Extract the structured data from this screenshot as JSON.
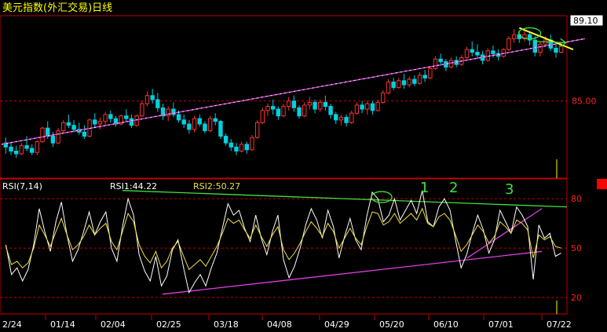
{
  "header": {
    "title": "美元指数(外汇交易)日线"
  },
  "chart_data": [
    {
      "type": "candlestick",
      "title": "美元指数(外汇交易)日线",
      "ylim": [
        79.3,
        91.3
      ],
      "y_ticks": [
        85.0
      ],
      "last_price_label": "89.10",
      "x_tick_labels": [
        "2/24",
        "01/14",
        "02/04",
        "02/25",
        "03/18",
        "04/08",
        "04/29",
        "05/20",
        "06/10",
        "07/01",
        "07/22"
      ],
      "series": [
        {
          "name": "",
          "values": [
            [
              81.9,
              82.3,
              81.1,
              81.6
            ],
            [
              81.6,
              81.9,
              81.0,
              81.3
            ],
            [
              81.3,
              81.7,
              80.8,
              81.1
            ],
            [
              81.1,
              81.9,
              81.0,
              81.7
            ],
            [
              81.7,
              82.4,
              81.3,
              81.5
            ],
            [
              81.5,
              81.8,
              81.0,
              81.2
            ],
            [
              81.2,
              82.1,
              81.0,
              82.0
            ],
            [
              82.0,
              83.1,
              81.9,
              83.0
            ],
            [
              83.0,
              83.5,
              82.2,
              82.4
            ],
            [
              82.4,
              82.7,
              81.6,
              81.9
            ],
            [
              81.9,
              83.0,
              81.8,
              82.8
            ],
            [
              82.8,
              83.6,
              82.6,
              83.4
            ],
            [
              83.4,
              84.0,
              83.0,
              83.2
            ],
            [
              83.2,
              83.6,
              82.7,
              82.9
            ],
            [
              82.9,
              83.4,
              82.5,
              82.7
            ],
            [
              82.7,
              83.2,
              82.2,
              82.4
            ],
            [
              82.4,
              83.7,
              82.3,
              83.6
            ],
            [
              83.6,
              84.1,
              83.0,
              83.3
            ],
            [
              83.3,
              83.8,
              82.9,
              83.5
            ],
            [
              83.5,
              84.2,
              83.2,
              84.0
            ],
            [
              84.0,
              84.3,
              83.4,
              83.7
            ],
            [
              83.7,
              83.9,
              83.1,
              83.3
            ],
            [
              83.3,
              84.0,
              83.2,
              83.9
            ],
            [
              83.9,
              84.4,
              83.5,
              83.7
            ],
            [
              83.7,
              84.0,
              83.0,
              83.2
            ],
            [
              83.2,
              84.0,
              83.1,
              83.9
            ],
            [
              83.9,
              85.0,
              83.8,
              84.8
            ],
            [
              84.8,
              85.7,
              84.6,
              85.4
            ],
            [
              85.4,
              85.9,
              84.8,
              85.1
            ],
            [
              85.1,
              85.6,
              84.2,
              84.5
            ],
            [
              84.5,
              84.8,
              83.6,
              83.9
            ],
            [
              83.9,
              84.6,
              83.5,
              84.4
            ],
            [
              84.4,
              84.9,
              83.8,
              84.0
            ],
            [
              84.0,
              84.3,
              83.4,
              83.6
            ],
            [
              83.6,
              84.0,
              83.0,
              83.3
            ],
            [
              83.3,
              83.6,
              82.6,
              82.9
            ],
            [
              82.9,
              83.9,
              82.7,
              83.7
            ],
            [
              83.7,
              84.0,
              83.1,
              83.3
            ],
            [
              83.3,
              83.5,
              82.6,
              82.8
            ],
            [
              82.8,
              83.9,
              82.7,
              83.7
            ],
            [
              83.7,
              84.1,
              83.2,
              83.5
            ],
            [
              83.5,
              83.6,
              82.2,
              82.4
            ],
            [
              82.4,
              82.6,
              81.7,
              81.9
            ],
            [
              81.9,
              82.2,
              81.3,
              81.6
            ],
            [
              81.6,
              81.9,
              81.0,
              81.3
            ],
            [
              81.3,
              82.0,
              81.2,
              81.8
            ],
            [
              81.8,
              82.0,
              81.1,
              81.4
            ],
            [
              81.4,
              82.5,
              81.3,
              82.3
            ],
            [
              82.3,
              83.6,
              82.2,
              83.4
            ],
            [
              83.4,
              84.5,
              83.3,
              84.3
            ],
            [
              84.3,
              84.8,
              83.9,
              84.6
            ],
            [
              84.6,
              85.1,
              84.0,
              84.4
            ],
            [
              84.4,
              84.6,
              83.6,
              83.9
            ],
            [
              83.9,
              84.8,
              83.8,
              84.6
            ],
            [
              84.6,
              85.3,
              84.3,
              85.0
            ],
            [
              85.0,
              85.4,
              84.2,
              84.5
            ],
            [
              84.5,
              84.7,
              83.7,
              83.9
            ],
            [
              83.9,
              84.9,
              83.8,
              84.7
            ],
            [
              84.7,
              85.3,
              84.4,
              84.9
            ],
            [
              84.9,
              85.1,
              84.1,
              84.4
            ],
            [
              84.4,
              85.1,
              84.2,
              84.9
            ],
            [
              84.9,
              85.4,
              84.3,
              84.6
            ],
            [
              84.6,
              84.8,
              83.7,
              84.0
            ],
            [
              84.0,
              84.2,
              83.3,
              83.6
            ],
            [
              83.6,
              84.0,
              83.2,
              83.8
            ],
            [
              83.8,
              84.0,
              83.1,
              83.4
            ],
            [
              83.4,
              84.3,
              83.3,
              84.1
            ],
            [
              84.1,
              84.9,
              84.0,
              84.7
            ],
            [
              84.7,
              85.0,
              84.1,
              84.4
            ],
            [
              84.4,
              85.0,
              84.0,
              84.8
            ],
            [
              84.8,
              85.0,
              84.0,
              84.3
            ],
            [
              84.3,
              85.1,
              84.2,
              84.9
            ],
            [
              84.9,
              85.8,
              84.8,
              85.6
            ],
            [
              85.6,
              86.6,
              85.5,
              86.4
            ],
            [
              86.4,
              86.7,
              85.8,
              86.0
            ],
            [
              86.0,
              86.7,
              85.9,
              86.5
            ],
            [
              86.5,
              87.0,
              85.9,
              86.2
            ],
            [
              86.2,
              86.8,
              86.0,
              86.6
            ],
            [
              86.6,
              86.9,
              86.1,
              86.3
            ],
            [
              86.3,
              87.1,
              86.2,
              86.9
            ],
            [
              86.9,
              87.3,
              86.4,
              86.7
            ],
            [
              86.7,
              87.6,
              86.6,
              87.4
            ],
            [
              87.4,
              88.3,
              87.3,
              88.1
            ],
            [
              88.1,
              88.5,
              87.6,
              87.9
            ],
            [
              87.9,
              88.1,
              87.2,
              87.5
            ],
            [
              87.5,
              88.2,
              87.4,
              88.0
            ],
            [
              88.0,
              88.3,
              87.5,
              87.7
            ],
            [
              87.7,
              88.4,
              87.6,
              88.2
            ],
            [
              88.2,
              89.0,
              88.1,
              88.8
            ],
            [
              88.8,
              89.4,
              88.3,
              88.6
            ],
            [
              88.6,
              89.2,
              88.1,
              88.4
            ],
            [
              88.4,
              88.7,
              87.7,
              88.0
            ],
            [
              88.0,
              88.9,
              87.9,
              88.7
            ],
            [
              88.7,
              89.1,
              88.2,
              88.5
            ],
            [
              88.5,
              88.8,
              88.0,
              88.3
            ],
            [
              88.3,
              88.9,
              88.2,
              88.8
            ],
            [
              88.8,
              89.8,
              88.7,
              89.6
            ],
            [
              89.6,
              90.3,
              89.3,
              89.9
            ],
            [
              89.9,
              90.2,
              89.3,
              89.6
            ],
            [
              89.6,
              90.2,
              89.4,
              89.9
            ],
            [
              89.9,
              90.1,
              89.1,
              89.5
            ],
            [
              89.5,
              89.8,
              88.3,
              88.6
            ],
            [
              88.6,
              89.4,
              88.3,
              89.2
            ],
            [
              89.2,
              89.8,
              89.0,
              89.5
            ],
            [
              89.5,
              89.9,
              88.7,
              88.9
            ],
            [
              88.9,
              89.2,
              88.2,
              88.6
            ],
            [
              88.6,
              89.3,
              88.5,
              89.1
            ]
          ]
        }
      ],
      "annotations": [
        "ellipse-near-top",
        "down-arrow"
      ]
    },
    {
      "type": "line",
      "title": "RSI(7,14)",
      "ylim": [
        10,
        92
      ],
      "y_ticks": [
        80,
        50,
        20
      ],
      "x_tick_labels": [
        "2/24",
        "01/14",
        "02/04",
        "02/25",
        "03/18",
        "04/08",
        "04/29",
        "05/20",
        "06/10",
        "07/01",
        "07/22"
      ],
      "series": [
        {
          "name": "RSI1",
          "last_value_label": "RSI1:44.22",
          "values": [
            52,
            34,
            38,
            30,
            37,
            52,
            74,
            60,
            48,
            66,
            78,
            58,
            42,
            49,
            60,
            72,
            58,
            66,
            72,
            50,
            42,
            63,
            80,
            70,
            46,
            36,
            30,
            45,
            27,
            33,
            49,
            55,
            38,
            23,
            29,
            34,
            27,
            38,
            47,
            62,
            77,
            70,
            73,
            62,
            54,
            70,
            56,
            46,
            60,
            70,
            43,
            32,
            39,
            50,
            64,
            74,
            67,
            56,
            73,
            63,
            44,
            57,
            68,
            55,
            49,
            69,
            84,
            80,
            66,
            70,
            80,
            67,
            73,
            79,
            71,
            85,
            66,
            63,
            75,
            80,
            73,
            55,
            38,
            46,
            59,
            70,
            61,
            47,
            55,
            73,
            66,
            59,
            75,
            70,
            63,
            31,
            64,
            56,
            59,
            45,
            47
          ]
        },
        {
          "name": "RSI2",
          "last_value_label": "RSI2:50.27",
          "values": [
            51,
            40,
            42,
            38,
            41,
            50,
            64,
            58,
            51,
            60,
            68,
            58,
            49,
            52,
            57,
            64,
            58,
            62,
            65,
            54,
            49,
            60,
            71,
            66,
            52,
            45,
            41,
            48,
            38,
            42,
            50,
            54,
            45,
            37,
            40,
            43,
            39,
            45,
            51,
            59,
            68,
            65,
            67,
            61,
            56,
            64,
            57,
            51,
            58,
            63,
            49,
            43,
            47,
            53,
            60,
            66,
            62,
            57,
            65,
            60,
            50,
            56,
            62,
            56,
            52,
            63,
            72,
            71,
            64,
            66,
            71,
            65,
            68,
            71,
            67,
            74,
            65,
            63,
            69,
            71,
            67,
            58,
            48,
            52,
            58,
            64,
            60,
            53,
            57,
            66,
            63,
            59,
            67,
            65,
            61,
            44,
            58,
            55,
            57,
            51,
            50
          ]
        }
      ],
      "annotations": [
        "1",
        "2",
        "3"
      ]
    }
  ],
  "colors": {
    "background": "#000000",
    "grid": "#c00000",
    "up": "#ff3030",
    "down": "#00d0e0",
    "rsi1": "#ffffff",
    "rsi2": "#f0e040",
    "trend_magenta": "#e040e0",
    "trend_green": "#40e040",
    "trend_yellow": "#ffff30",
    "label_yellow": "#ffff00",
    "axis_red": "#ff2020"
  }
}
